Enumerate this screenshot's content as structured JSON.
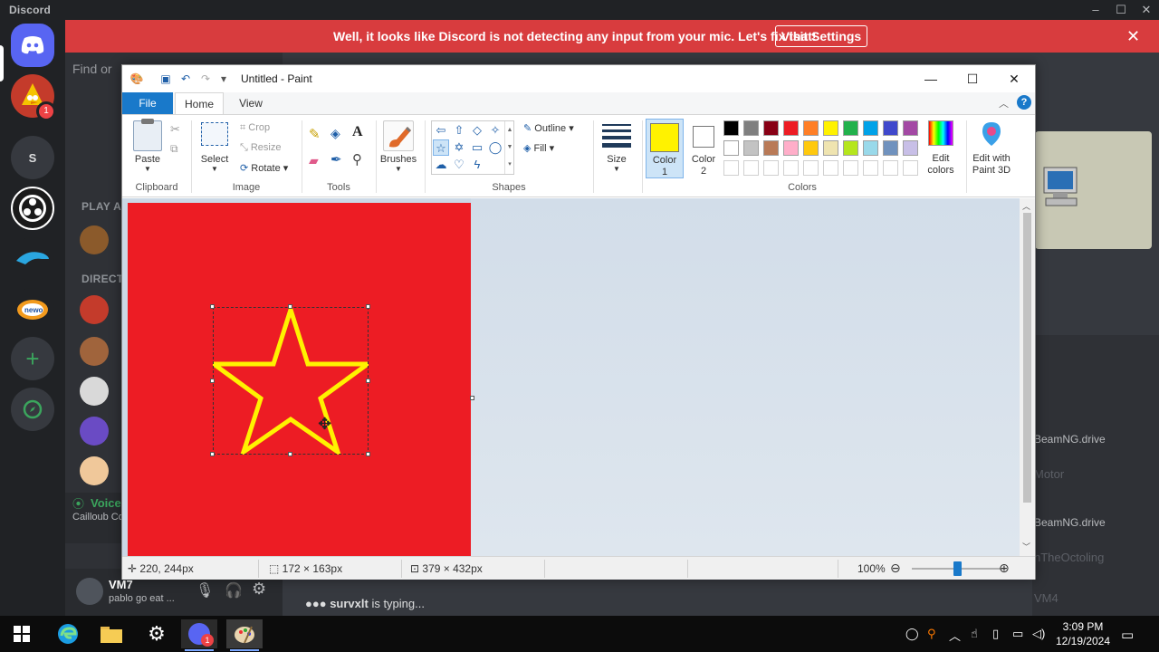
{
  "discord": {
    "app_name": "Discord",
    "banner": {
      "text": "Well, it looks like Discord is not detecting any input from your mic. Let's fix that!",
      "button": "Visit Settings"
    },
    "search_placeholder": "Find or",
    "server_initial": "S",
    "sections": {
      "play": "PLAY AC",
      "direct": "DIRECT"
    },
    "server_badge": "1",
    "voice": {
      "status": "Voice",
      "channel": "Cailloub Co"
    },
    "user": {
      "name": "VM7",
      "status": "pablo go eat ..."
    },
    "typing": {
      "user": "survxlt",
      "suffix": " is typing..."
    },
    "members": [
      "BeamNG.drive",
      "Motor",
      "BeamNG.drive",
      "nTheOctoling",
      "VM4"
    ]
  },
  "paint": {
    "title": "Untitled - Paint",
    "tabs": {
      "file": "File",
      "home": "Home",
      "view": "View"
    },
    "clipboard": {
      "paste": "Paste",
      "label": "Clipboard"
    },
    "image": {
      "select": "Select",
      "crop": "Crop",
      "resize": "Resize",
      "rotate": "Rotate",
      "label": "Image"
    },
    "tools": {
      "label": "Tools"
    },
    "brushes": {
      "label": "Brushes"
    },
    "shapes": {
      "outline": "Outline",
      "fill": "Fill",
      "label": "Shapes"
    },
    "size": {
      "label": "Size"
    },
    "colors": {
      "color1_label": "Color",
      "color1_num": "1",
      "color2_label": "Color",
      "color2_num": "2",
      "edit_colors": "Edit colors",
      "edit_paint3d": "Edit with Paint 3D",
      "label": "Colors",
      "color1": "#fff200",
      "color2": "#ffffff",
      "palette": [
        "#000000",
        "#7f7f7f",
        "#880015",
        "#ed1c24",
        "#ff7f27",
        "#fff200",
        "#22b14c",
        "#00a2e8",
        "#3f48cc",
        "#a349a4",
        "#ffffff",
        "#c3c3c3",
        "#b97a57",
        "#ffaec9",
        "#ffc90e",
        "#efe4b0",
        "#b5e61d",
        "#99d9ea",
        "#7092be",
        "#c8bfe7"
      ]
    },
    "canvas": {
      "background": "#ed1c24",
      "star_color": "#fff200"
    },
    "status": {
      "cursor": "220, 244px",
      "selection": "172 × 163px",
      "canvas_size": "379 × 432px",
      "zoom": "100%",
      "zoom_fraction": 0.5
    }
  },
  "taskbar": {
    "time": "3:09 PM",
    "date": "12/19/2024",
    "discord_badge": "1"
  }
}
